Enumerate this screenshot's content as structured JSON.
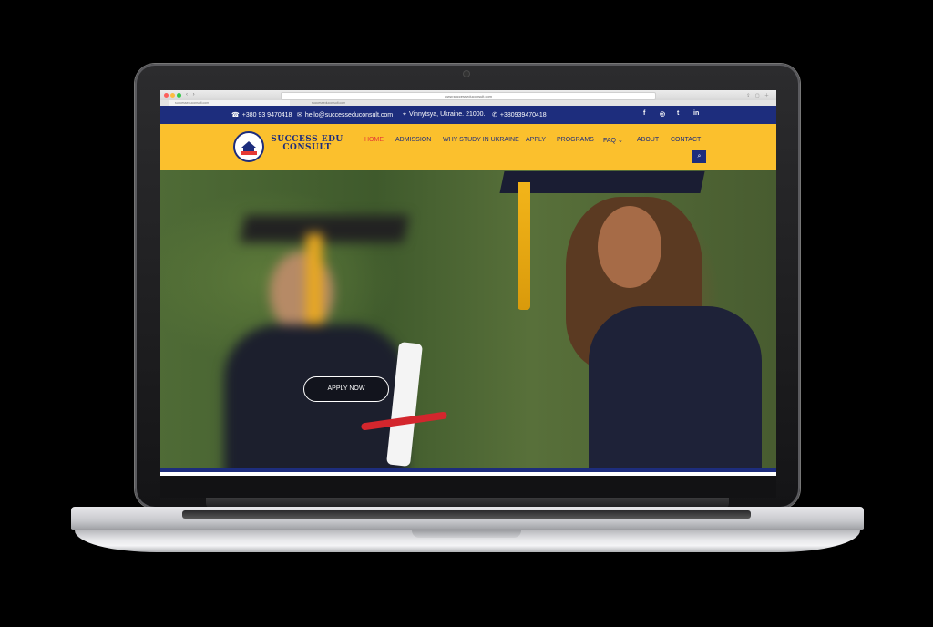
{
  "browser": {
    "url": "www.successeduconsult.com",
    "tabs": [
      "successeduconsult.com",
      "successeduconsult.com"
    ]
  },
  "topbar": {
    "phone": "+380 93 9470418",
    "email": "hello@successeduconsult.com",
    "location": "Vinnytsya, Ukraine. 21000.",
    "whatsapp": "+380939470418",
    "social": [
      "f",
      "◎",
      "t",
      "in"
    ]
  },
  "header": {
    "logo_line1": "SUCCESS EDU",
    "logo_line2": "CONSULT",
    "menu": [
      "HOME",
      "ADMISSION",
      "WHY STUDY IN UKRAINE",
      "APPLY",
      "PROGRAMS",
      "FAQ",
      "ABOUT",
      "CONTACT"
    ],
    "active_item": "HOME",
    "search_icon": "search-icon"
  },
  "hero": {
    "cta": "APPLY NOW"
  },
  "colors": {
    "navy": "#1d2d7d",
    "yellow": "#fbc02d",
    "active": "#e53935"
  }
}
